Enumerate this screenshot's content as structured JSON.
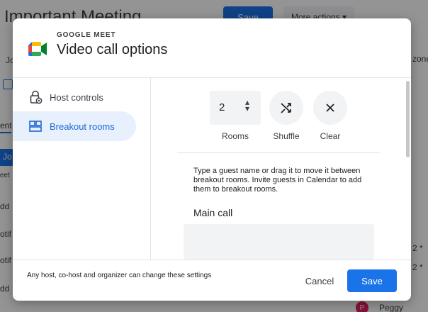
{
  "background": {
    "event_title": "Important Meeting",
    "save_label": "Save",
    "more_actions_label": "More actions",
    "left_fragments": [
      "Jo",
      "ent",
      "Jo",
      "eet",
      "dd",
      "otif",
      "otif",
      "dd"
    ],
    "right_fragments": [
      "zone",
      "2 *",
      "2 *"
    ],
    "guest_name": "Peggy",
    "guest_initial": "P"
  },
  "modal": {
    "eyebrow": "GOOGLE MEET",
    "title": "Video call options",
    "nav": [
      {
        "label": "Host controls",
        "icon": "lock-gear-icon",
        "active": false
      },
      {
        "label": "Breakout rooms",
        "icon": "breakout-rooms-icon",
        "active": true
      }
    ],
    "rooms": {
      "value": "2",
      "label": "Rooms"
    },
    "shuffle_label": "Shuffle",
    "clear_label": "Clear",
    "instructions": "Type a guest name or drag it to move it between breakout rooms. Invite guests in Calendar to add them to breakout rooms.",
    "main_call_label": "Main call",
    "footer_note": "Any host, co-host and organizer can change these settings",
    "cancel_label": "Cancel",
    "save_label": "Save"
  },
  "colors": {
    "accent": "#1a73e8",
    "active_nav_bg": "#e8f0fe",
    "overlay": "rgba(0,0,0,0.42)"
  }
}
